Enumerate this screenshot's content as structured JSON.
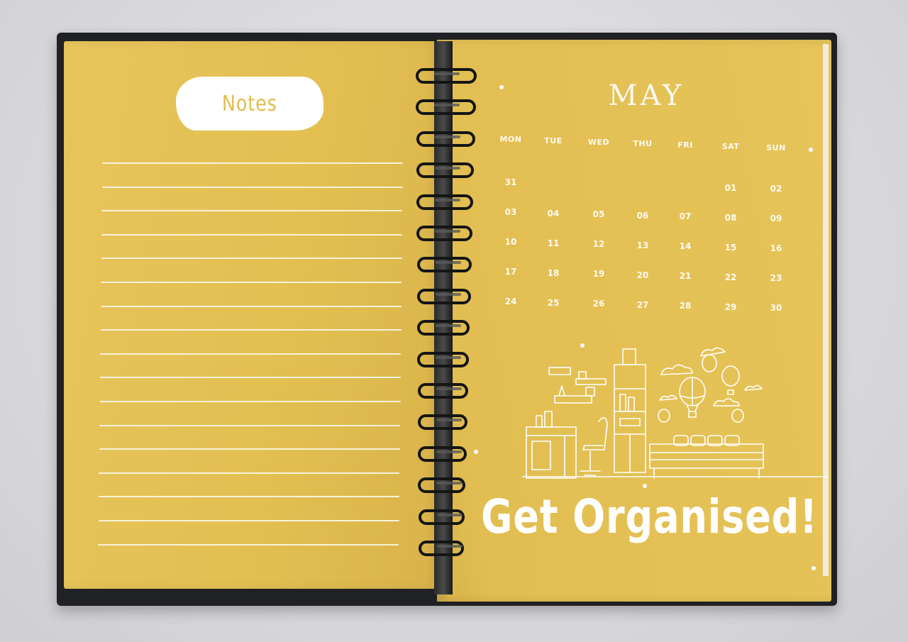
{
  "notes_page": {
    "heading": "Notes",
    "ruled_line_count": 17
  },
  "calendar_page": {
    "month": "MAY",
    "weekdays": [
      "MON",
      "TUE",
      "WED",
      "THU",
      "FRI",
      "SAT",
      "SUN"
    ],
    "weeks": [
      [
        "31",
        "",
        "",
        "",
        "",
        "01",
        "02"
      ],
      [
        "03",
        "04",
        "05",
        "06",
        "07",
        "08",
        "09"
      ],
      [
        "10",
        "11",
        "12",
        "13",
        "14",
        "15",
        "16"
      ],
      [
        "17",
        "18",
        "19",
        "20",
        "21",
        "22",
        "23"
      ],
      [
        "24",
        "25",
        "26",
        "27",
        "28",
        "29",
        "30"
      ]
    ],
    "slogan": "Get Organised!"
  },
  "colors": {
    "page_yellow": "#e3bf52",
    "ink_white": "#ffffff",
    "cover_black": "#202124",
    "coil_black": "#151515"
  },
  "icons": [
    "spiral-binding-icon",
    "desk-room-illustration-icon",
    "hot-air-balloon-icon",
    "cloud-icon"
  ]
}
